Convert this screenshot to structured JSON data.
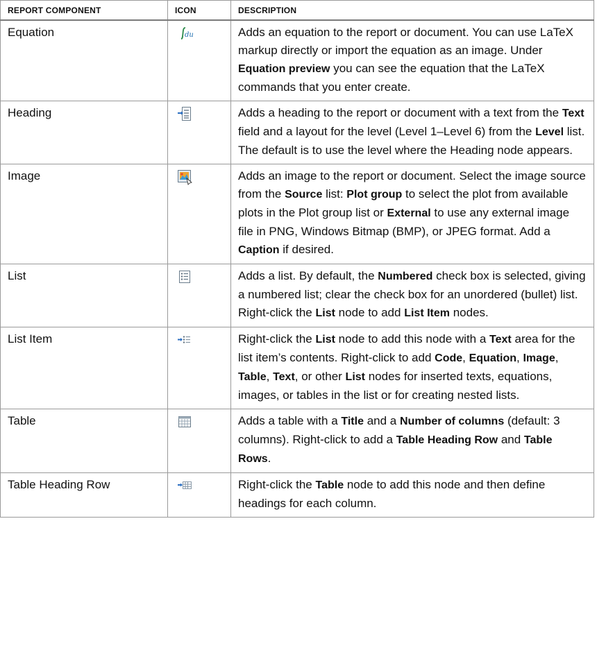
{
  "table": {
    "headers": {
      "component": "REPORT COMPONENT",
      "icon": "ICON",
      "description": "DESCRIPTION"
    },
    "rows": [
      {
        "name": "Equation",
        "icon": "equation-icon",
        "description": [
          {
            "t": "Adds an equation to the report or document. You can use LaTeX markup directly or import the equation as an image. Under "
          },
          {
            "t": "Equation preview",
            "b": true
          },
          {
            "t": " you can see the equation that the LaTeX commands that you enter create."
          }
        ]
      },
      {
        "name": "Heading",
        "icon": "heading-icon",
        "description": [
          {
            "t": "Adds a heading to the report or document with a text from the "
          },
          {
            "t": "Text",
            "b": true
          },
          {
            "t": " field and a layout for the level (Level 1–Level 6) from the "
          },
          {
            "t": "Level",
            "b": true
          },
          {
            "t": " list. The default is to use the level where the Heading node appears."
          }
        ]
      },
      {
        "name": "Image",
        "icon": "image-icon",
        "description": [
          {
            "t": "Adds an image to the report or document. Select the image source from the "
          },
          {
            "t": "Source",
            "b": true
          },
          {
            "t": " list: "
          },
          {
            "t": "Plot group",
            "b": true
          },
          {
            "t": " to select the plot from available plots in the Plot group list or "
          },
          {
            "t": "External",
            "b": true
          },
          {
            "t": " to use any external image file in PNG, Windows Bitmap (BMP), or JPEG format. Add a "
          },
          {
            "t": "Caption",
            "b": true
          },
          {
            "t": " if desired."
          }
        ]
      },
      {
        "name": "List",
        "icon": "list-icon",
        "description": [
          {
            "t": "Adds a list. By default, the "
          },
          {
            "t": "Numbered",
            "b": true
          },
          {
            "t": " check box is selected, giving a numbered list; clear the check box for an unordered (bullet) list. Right-click the "
          },
          {
            "t": "List",
            "b": true
          },
          {
            "t": " node to add "
          },
          {
            "t": "List Item",
            "b": true
          },
          {
            "t": " nodes."
          }
        ]
      },
      {
        "name": "List Item",
        "icon": "list-item-icon",
        "description": [
          {
            "t": "Right-click the "
          },
          {
            "t": "List",
            "b": true
          },
          {
            "t": " node to add this node with a "
          },
          {
            "t": "Text",
            "b": true
          },
          {
            "t": " area for the list item’s contents. Right-click to add "
          },
          {
            "t": "Code",
            "b": true
          },
          {
            "t": ", "
          },
          {
            "t": "Equation",
            "b": true
          },
          {
            "t": ", "
          },
          {
            "t": "Image",
            "b": true
          },
          {
            "t": ", "
          },
          {
            "t": "Table",
            "b": true
          },
          {
            "t": ", "
          },
          {
            "t": "Text",
            "b": true
          },
          {
            "t": ", or other "
          },
          {
            "t": "List",
            "b": true
          },
          {
            "t": " nodes for inserted texts, equations, images, or tables in the list or for creating nested lists."
          }
        ]
      },
      {
        "name": "Table",
        "icon": "table-icon",
        "description": [
          {
            "t": "Adds a table with a "
          },
          {
            "t": "Title",
            "b": true
          },
          {
            "t": " and a "
          },
          {
            "t": "Number of columns",
            "b": true
          },
          {
            "t": " (default: 3 columns). Right-click to add a "
          },
          {
            "t": "Table Heading Row",
            "b": true
          },
          {
            "t": " and "
          },
          {
            "t": "Table Rows",
            "b": true
          },
          {
            "t": "."
          }
        ]
      },
      {
        "name": "Table Heading Row",
        "icon": "table-heading-row-icon",
        "description": [
          {
            "t": "Right-click the "
          },
          {
            "t": "Table",
            "b": true
          },
          {
            "t": " node to add this node and then define headings for each column."
          }
        ]
      }
    ]
  }
}
